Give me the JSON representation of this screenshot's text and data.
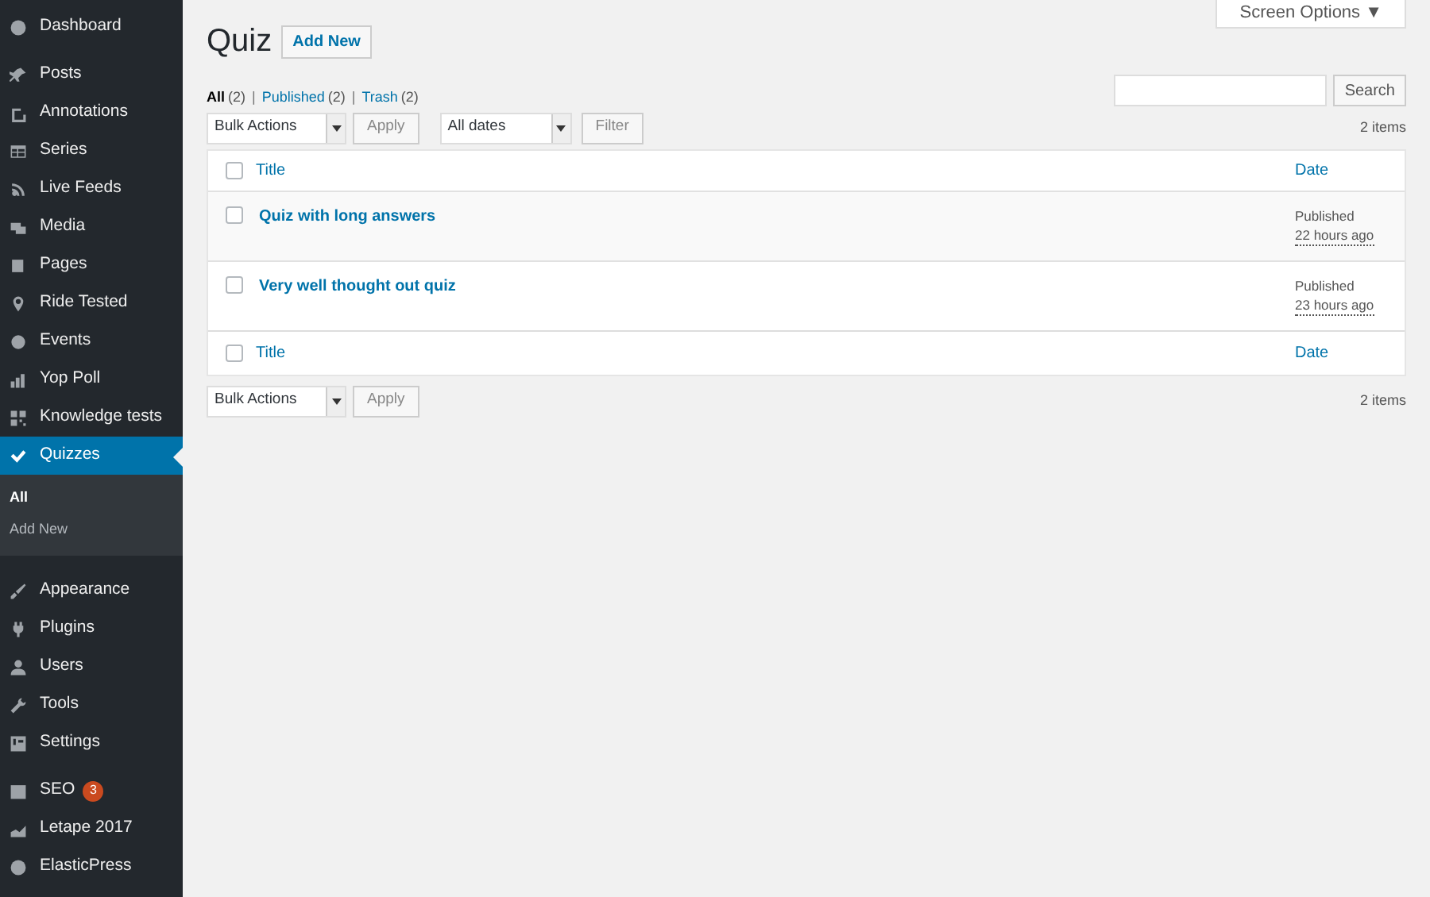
{
  "sidebar": {
    "groups": [
      {
        "items": [
          {
            "label": "Dashboard",
            "selected": false
          }
        ]
      },
      {
        "items": [
          {
            "label": "Posts",
            "selected": false
          },
          {
            "label": "Annotations",
            "selected": false
          },
          {
            "label": "Series",
            "selected": false
          },
          {
            "label": "Live Feeds",
            "selected": false
          },
          {
            "label": "Media",
            "selected": false
          },
          {
            "label": "Pages",
            "selected": false
          },
          {
            "label": "Ride Tested",
            "selected": false
          },
          {
            "label": "Events",
            "selected": false
          },
          {
            "label": "Yop Poll",
            "selected": false
          },
          {
            "label": "Knowledge tests",
            "selected": false
          },
          {
            "label": "Quizzes",
            "selected": true,
            "submenu": [
              {
                "label": "All",
                "selected": true
              },
              {
                "label": "Add New",
                "selected": false
              }
            ]
          },
          {
            "label": "Appearance",
            "selected": false
          },
          {
            "label": "Plugins",
            "selected": false
          },
          {
            "label": "Users",
            "selected": false
          },
          {
            "label": "Tools",
            "selected": false
          },
          {
            "label": "Settings",
            "selected": false
          }
        ]
      },
      {
        "items": [
          {
            "label": "SEO",
            "selected": false,
            "badge": "3"
          },
          {
            "label": "Letape 2017",
            "selected": false
          },
          {
            "label": "ElasticPress",
            "selected": false
          }
        ]
      }
    ]
  },
  "screen_options": "Screen Options ▼",
  "page_title": "Quiz",
  "add_new": "Add New",
  "filter_separator": "|",
  "filters": [
    {
      "label": "All",
      "count": "(2)",
      "selected": true
    },
    {
      "label": "Published",
      "count": "(2)",
      "selected": false
    },
    {
      "label": "Trash",
      "count": "(2)",
      "selected": false
    }
  ],
  "search": {
    "button": "Search"
  },
  "top_actions": {
    "bulk": "Bulk Actions",
    "apply": "Apply",
    "dates": "All dates",
    "filter": "Filter",
    "count": "2 items"
  },
  "table": {
    "select_all_checked": false,
    "columns": [
      "Title",
      "Date"
    ],
    "rows": [
      {
        "title": "Quiz with long answers",
        "status": "Published",
        "time": "22 hours ago",
        "checked": false
      },
      {
        "title": "Very well thought out quiz",
        "status": "Published",
        "time": "23 hours ago",
        "checked": false
      }
    ],
    "footer_columns": [
      "Title",
      "Date"
    ]
  },
  "bottom_actions": {
    "bulk": "Bulk Actions",
    "apply": "Apply",
    "count": "2 items"
  }
}
